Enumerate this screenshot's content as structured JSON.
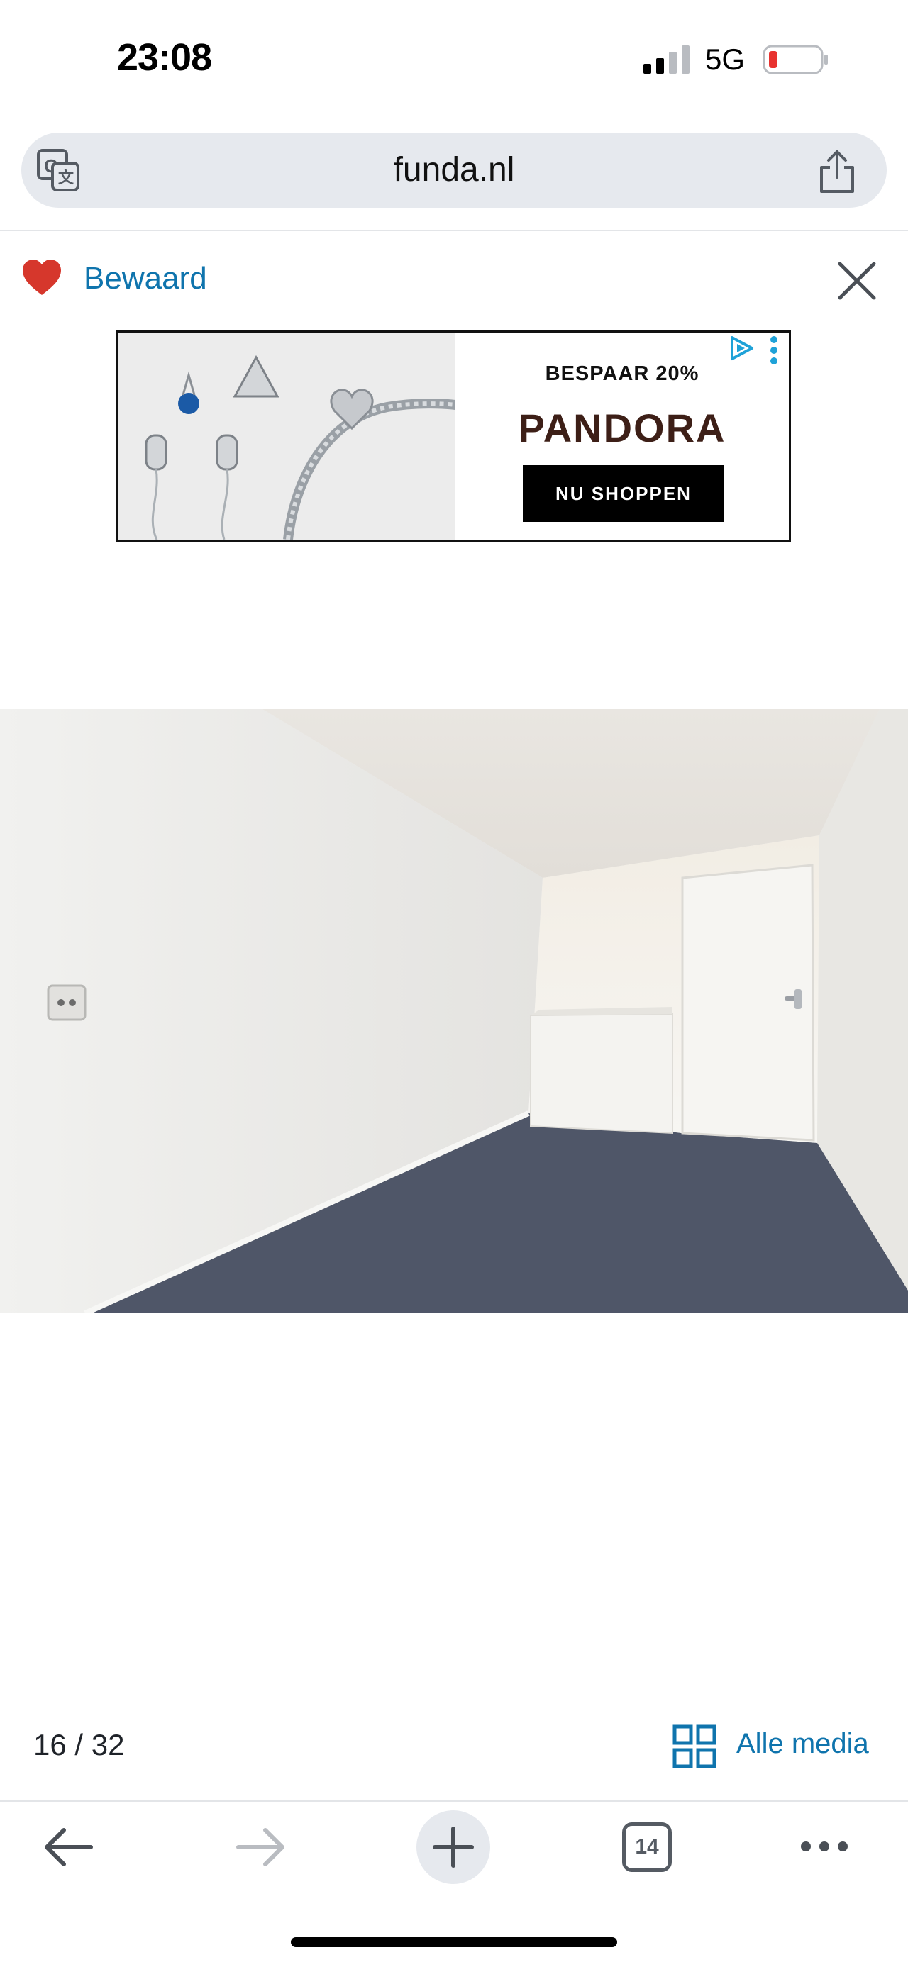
{
  "status_bar": {
    "time": "23:08",
    "network": "5G",
    "signal_bars_active": 2,
    "signal_bars_total": 4,
    "battery_level": 0.1,
    "battery_color": "#e8322f"
  },
  "browser": {
    "url": "funda.nl",
    "translate_icon": "translate-icon",
    "share_icon": "share-icon"
  },
  "listing_header": {
    "saved_label": "Bewaard",
    "heart_color": "#d6372c",
    "close_icon": "close-icon"
  },
  "ad": {
    "headline": "BESPAAR 20%",
    "brand": "PANDORA",
    "cta": "NU SHOPPEN",
    "choices_color": "#1fa2d8"
  },
  "media": {
    "counter": "16 / 32",
    "all_media_label": "Alle media",
    "accent_color": "#0f74ad"
  },
  "toolbar": {
    "tab_count": "14",
    "icons": [
      "back-icon",
      "forward-icon",
      "plus-icon",
      "tabs-icon",
      "more-icon"
    ]
  }
}
